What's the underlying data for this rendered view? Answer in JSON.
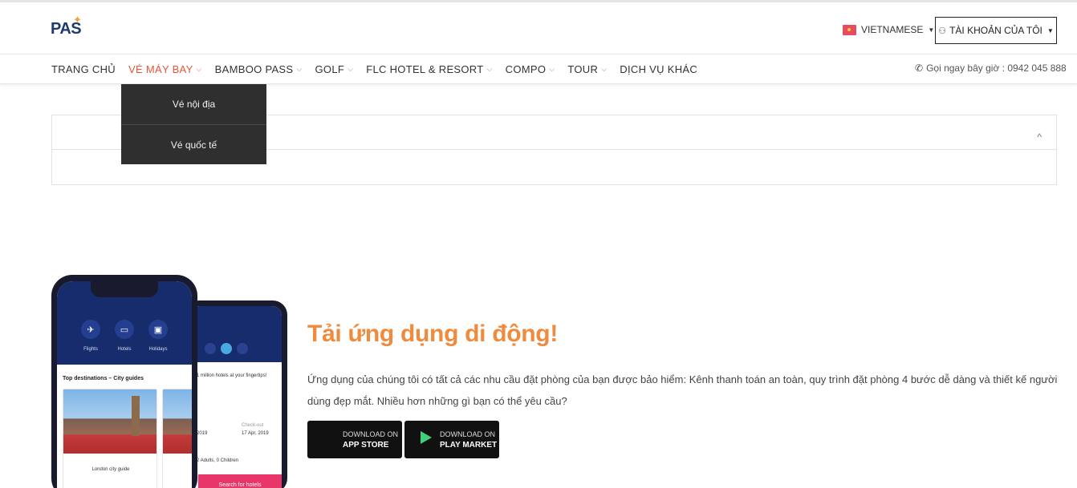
{
  "header": {
    "logo_text": "PAS",
    "language": "VIETNAMESE",
    "account_label": "TÀI KHOẢN CỦA TÔI"
  },
  "nav": {
    "items": [
      {
        "label": "TRANG CHỦ",
        "has_dropdown": false,
        "active": false
      },
      {
        "label": "VÉ MÁY BAY",
        "has_dropdown": true,
        "active": true
      },
      {
        "label": "BAMBOO PASS",
        "has_dropdown": true,
        "active": false
      },
      {
        "label": "GOLF",
        "has_dropdown": true,
        "active": false
      },
      {
        "label": "FLC HOTEL & RESORT",
        "has_dropdown": true,
        "active": false
      },
      {
        "label": "COMPO",
        "has_dropdown": true,
        "active": false
      },
      {
        "label": "TOUR",
        "has_dropdown": true,
        "active": false
      },
      {
        "label": "DỊCH VỤ KHÁC",
        "has_dropdown": false,
        "active": false
      }
    ],
    "phone_text": "Gọi ngay bây giờ : 0942 045 888"
  },
  "dropdown": {
    "items": [
      "Vé nội địa",
      "Vé quốc tế"
    ]
  },
  "app_section": {
    "title": "Tải ứng dụng di động!",
    "description": "Ứng dụng của chúng tôi có tất cả các nhu cầu đặt phòng của bạn được bảo hiểm: Kênh thanh toán an toàn, quy trình đặt phòng 4 bước dễ dàng và thiết kế người dùng đẹp mắt. Nhiều hơn những gì bạn có thể yêu cầu?",
    "app_store": {
      "line1": "DOWNLOAD ON",
      "line2": "APP STORE"
    },
    "play_market": {
      "line1": "DOWNLOAD ON",
      "line2": "PLAY MARKET"
    }
  },
  "phone_mockup": {
    "icons": [
      "Flights",
      "Hotels",
      "Holidays"
    ],
    "heading": "Top destinations – City guides",
    "card_caption": "London city guide",
    "back_tagline": "1 million hotels at your fingertips!",
    "back_date_in": "2019",
    "back_date_out": "17 Apr, 2019",
    "back_checkout_label": "Check-out",
    "back_guests": "2 Adults, 0 Children",
    "back_search": "Search for hotels"
  },
  "colors": {
    "accent": "#e8543a",
    "title_orange": "#f08a3c",
    "dropdown_bg": "#2f2f2f",
    "brand_navy": "#162c6d"
  }
}
